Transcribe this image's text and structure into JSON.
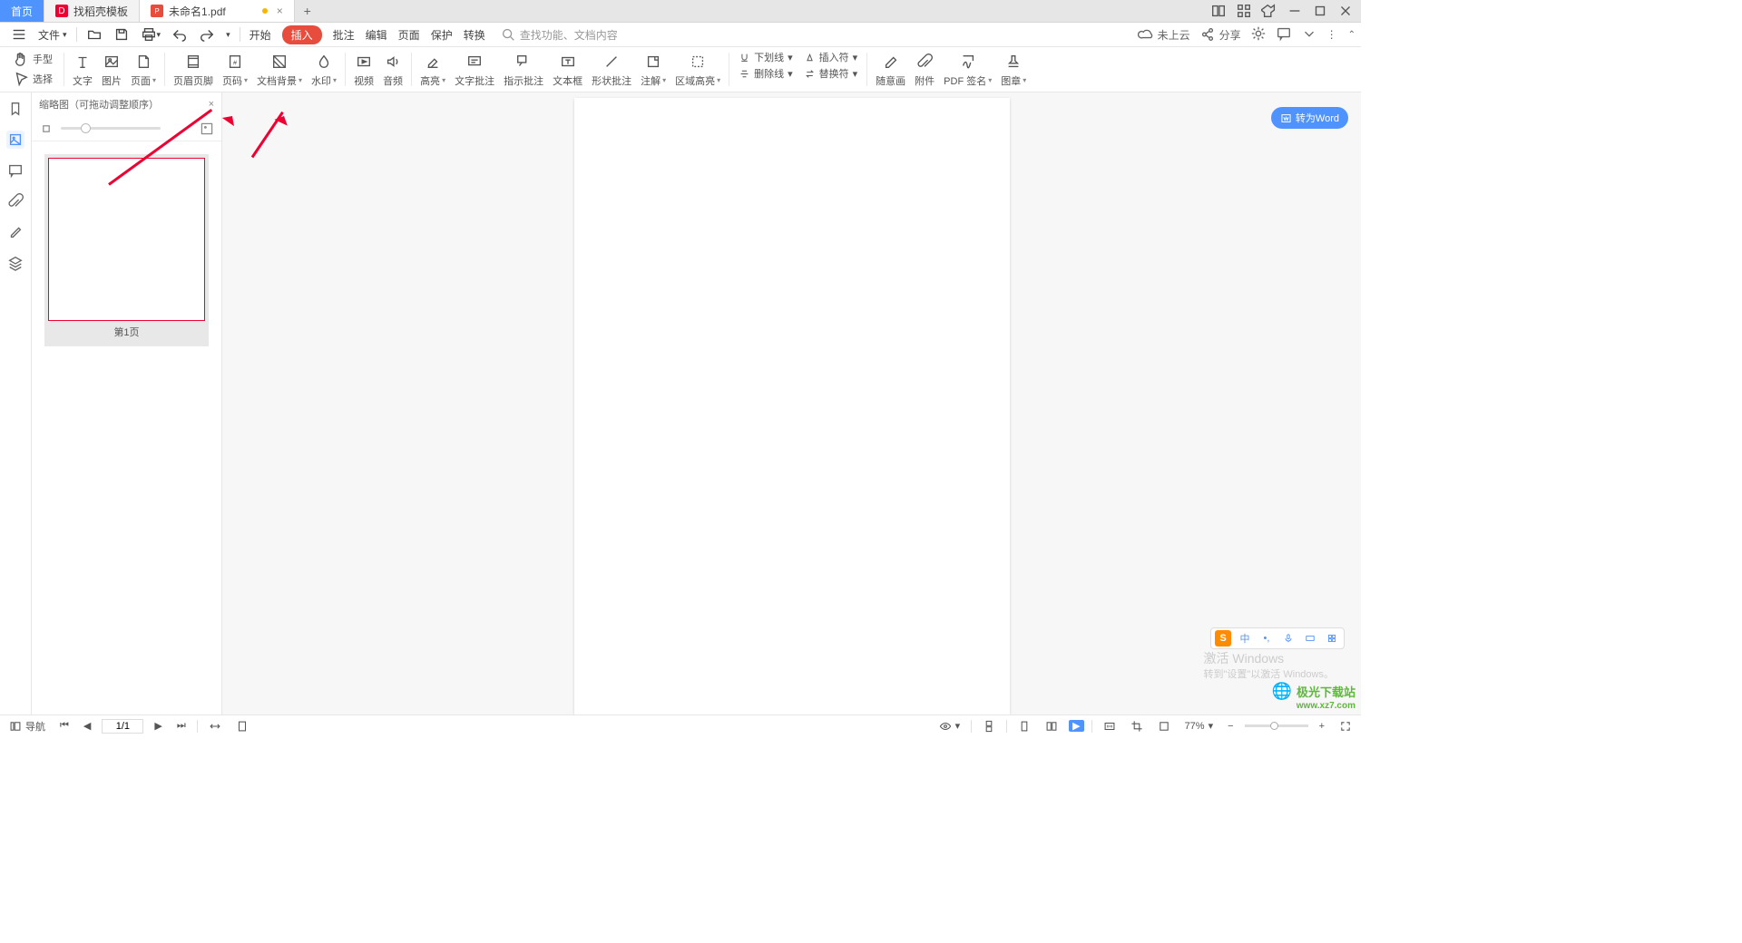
{
  "tabs": {
    "home": "首页",
    "templates": "找稻壳模板",
    "doc": "未命名1.pdf"
  },
  "menu": {
    "file": "文件",
    "start": "开始",
    "insert": "插入",
    "annotate": "批注",
    "edit": "编辑",
    "page": "页面",
    "protect": "保护",
    "convert": "转换",
    "search_ph": "查找功能、文档内容",
    "cloud": "未上云",
    "share": "分享"
  },
  "sel": {
    "hand": "手型",
    "select": "选择"
  },
  "ribbon": {
    "text": "文字",
    "image": "图片",
    "page": "页面",
    "headerfooter": "页眉页脚",
    "pagenum": "页码",
    "docbg": "文档背景",
    "watermark": "水印",
    "video": "视频",
    "audio": "音频",
    "highlight": "高亮",
    "textnote": "文字批注",
    "pointnote": "指示批注",
    "textbox": "文本框",
    "shapenote": "形状批注",
    "note": "注解",
    "areahl": "区域高亮",
    "underline": "下划线",
    "strikeout": "删除线",
    "insertchar": "插入符",
    "replacechar": "替换符",
    "freedraw": "随意画",
    "attachment": "附件",
    "pdfsign": "PDF 签名",
    "stamp": "图章"
  },
  "thumb": {
    "title": "缩略图（可拖动调整顺序）",
    "page1": "第1页"
  },
  "convert_word": "转为Word",
  "ime": {
    "zh": "中"
  },
  "watermark": {
    "t1": "激活 Windows",
    "t2": "转到\"设置\"以激活 Windows。"
  },
  "logo": {
    "name": "极光下载站",
    "url": "www.xz7.com"
  },
  "status": {
    "nav": "导航",
    "page": "1/1",
    "zoom": "77%"
  }
}
